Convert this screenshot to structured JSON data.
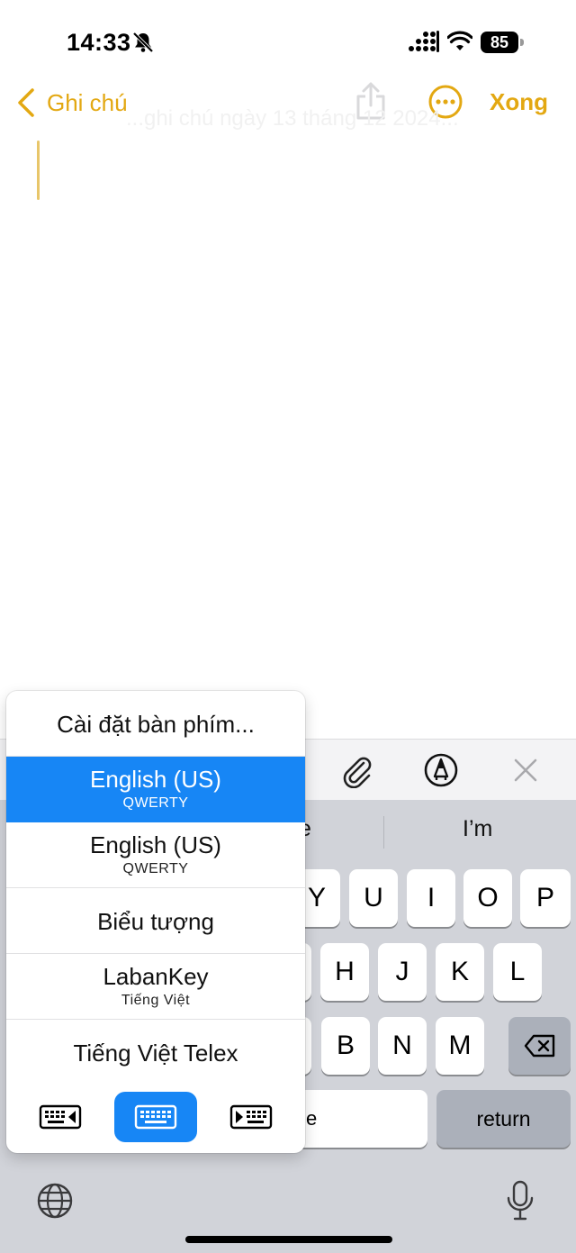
{
  "status_bar": {
    "time": "14:33",
    "battery": "85",
    "icons": [
      "bell-slash-icon",
      "signal-icon",
      "wifi-icon",
      "battery-icon"
    ]
  },
  "nav": {
    "back_label": "Ghi chú",
    "done_label": "Xong",
    "icons": [
      "chevron-left-icon",
      "share-icon",
      "more-icon"
    ],
    "accent_color": "#e3a812"
  },
  "note": {
    "faded_text": "...ghi chú ngày 13 tháng 12 2024..."
  },
  "toolbar": {
    "icons": [
      "paperclip-icon",
      "markup-pen-icon",
      "close-icon"
    ]
  },
  "keyboard": {
    "suggestions": [
      "e",
      "I’m"
    ],
    "row1": [
      "Y",
      "U",
      "I",
      "O",
      "P"
    ],
    "row2": [
      "H",
      "J",
      "K",
      "L"
    ],
    "row3": [
      "B",
      "N",
      "M"
    ],
    "space_partial": "e",
    "return_label": "return",
    "icons": [
      "delete-icon",
      "globe-icon",
      "microphone-icon"
    ]
  },
  "popup": {
    "items": [
      {
        "main": "Cài đặt bàn phím...",
        "sub": ""
      },
      {
        "main": "English (US)",
        "sub": "QWERTY",
        "selected": true
      },
      {
        "main": "English (US)",
        "sub": "QWERTY"
      },
      {
        "main": "Biểu tượng",
        "sub": ""
      },
      {
        "main": "LabanKey",
        "sub": "Tiếng Việt"
      },
      {
        "main": "Tiếng Việt Telex",
        "sub": ""
      }
    ],
    "modes": [
      "keyboard-left-icon",
      "keyboard-full-icon",
      "keyboard-right-icon"
    ],
    "selected_color": "#1786f5"
  }
}
